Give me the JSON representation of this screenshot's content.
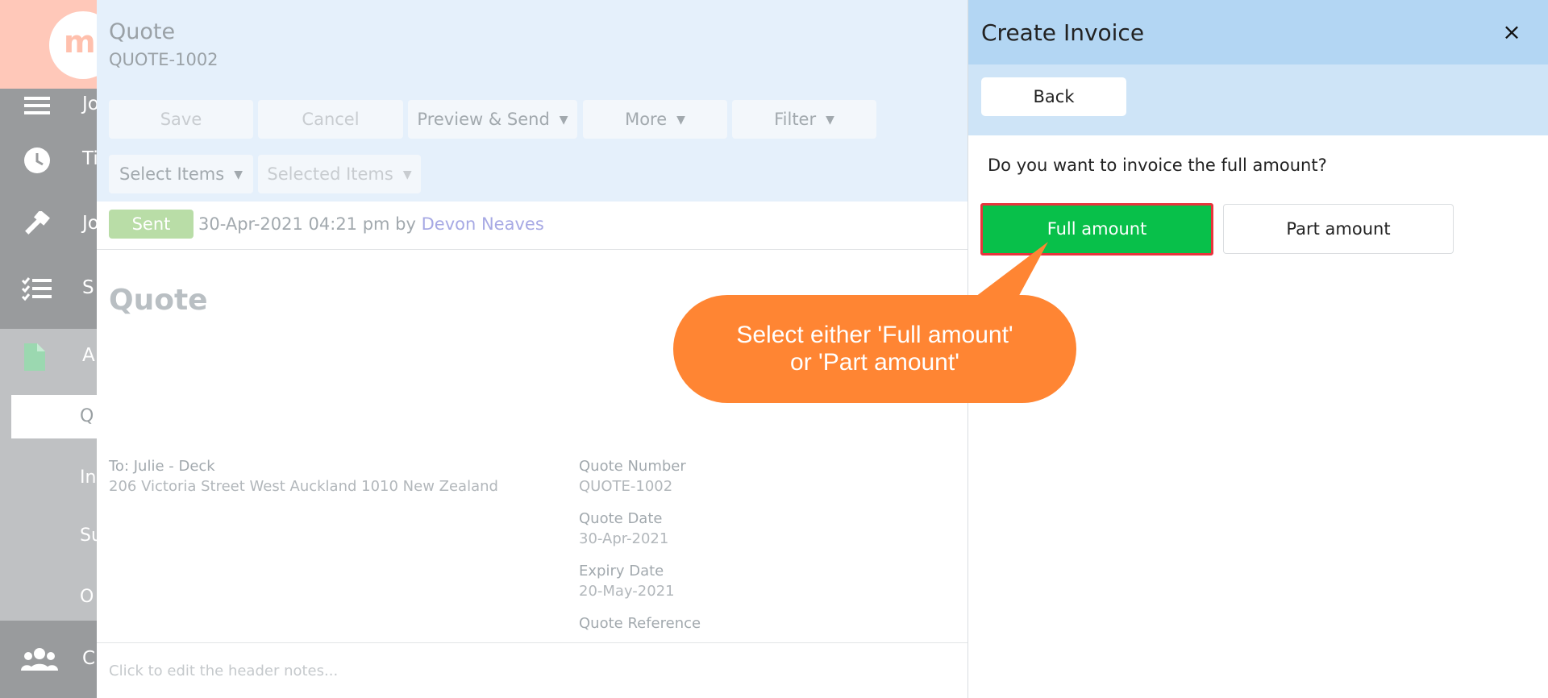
{
  "sidebar": {
    "logo_text": "m",
    "items": [
      {
        "label": "Jo",
        "icon": "menu-icon"
      },
      {
        "label": "Ti",
        "icon": "clock-icon"
      },
      {
        "label": "Jo",
        "icon": "hammer-icon"
      },
      {
        "label": "S",
        "icon": "checklist-icon"
      },
      {
        "label": "A",
        "icon": "document-icon"
      }
    ],
    "sub_items": [
      {
        "label": "Q",
        "active": true
      },
      {
        "label": "In"
      },
      {
        "label": "Su"
      },
      {
        "label": "O"
      }
    ],
    "bottom_item": {
      "label": "C",
      "icon": "users-icon"
    }
  },
  "quote": {
    "title": "Quote",
    "number": "QUOTE-1002",
    "toolbar": {
      "save": "Save",
      "cancel": "Cancel",
      "preview_send": "Preview & Send",
      "more": "More",
      "filter": "Filter",
      "select_items": "Select Items",
      "selected_items": "Selected Items"
    },
    "status": {
      "badge": "Sent",
      "date": "30-Apr-2021 04:21 pm by",
      "user": "Devon Neaves"
    },
    "doc_title": "Quote",
    "to_label": "To: Julie - Deck",
    "address": "206 Victoria Street West Auckland 1010 New Zealand",
    "meta": {
      "quote_number_label": "Quote Number",
      "quote_number": "QUOTE-1002",
      "quote_date_label": "Quote Date",
      "quote_date": "30-Apr-2021",
      "expiry_date_label": "Expiry Date",
      "expiry_date": "20-May-2021",
      "quote_reference_label": "Quote Reference"
    },
    "header_notes_placeholder": "Click to edit the header notes..."
  },
  "panel": {
    "title": "Create Invoice",
    "close": "×",
    "back": "Back",
    "question": "Do you want to invoice the full amount?",
    "full_amount": "Full amount",
    "part_amount": "Part amount"
  },
  "callout": {
    "line1": "Select either 'Full amount'",
    "line2": "or 'Part amount'"
  },
  "colors": {
    "panel_header": "#b3d6f3",
    "full_amount_bg": "#08c04a",
    "highlight_border": "#e8343c",
    "callout": "#ff8533",
    "sent_badge": "#b9dda7"
  }
}
